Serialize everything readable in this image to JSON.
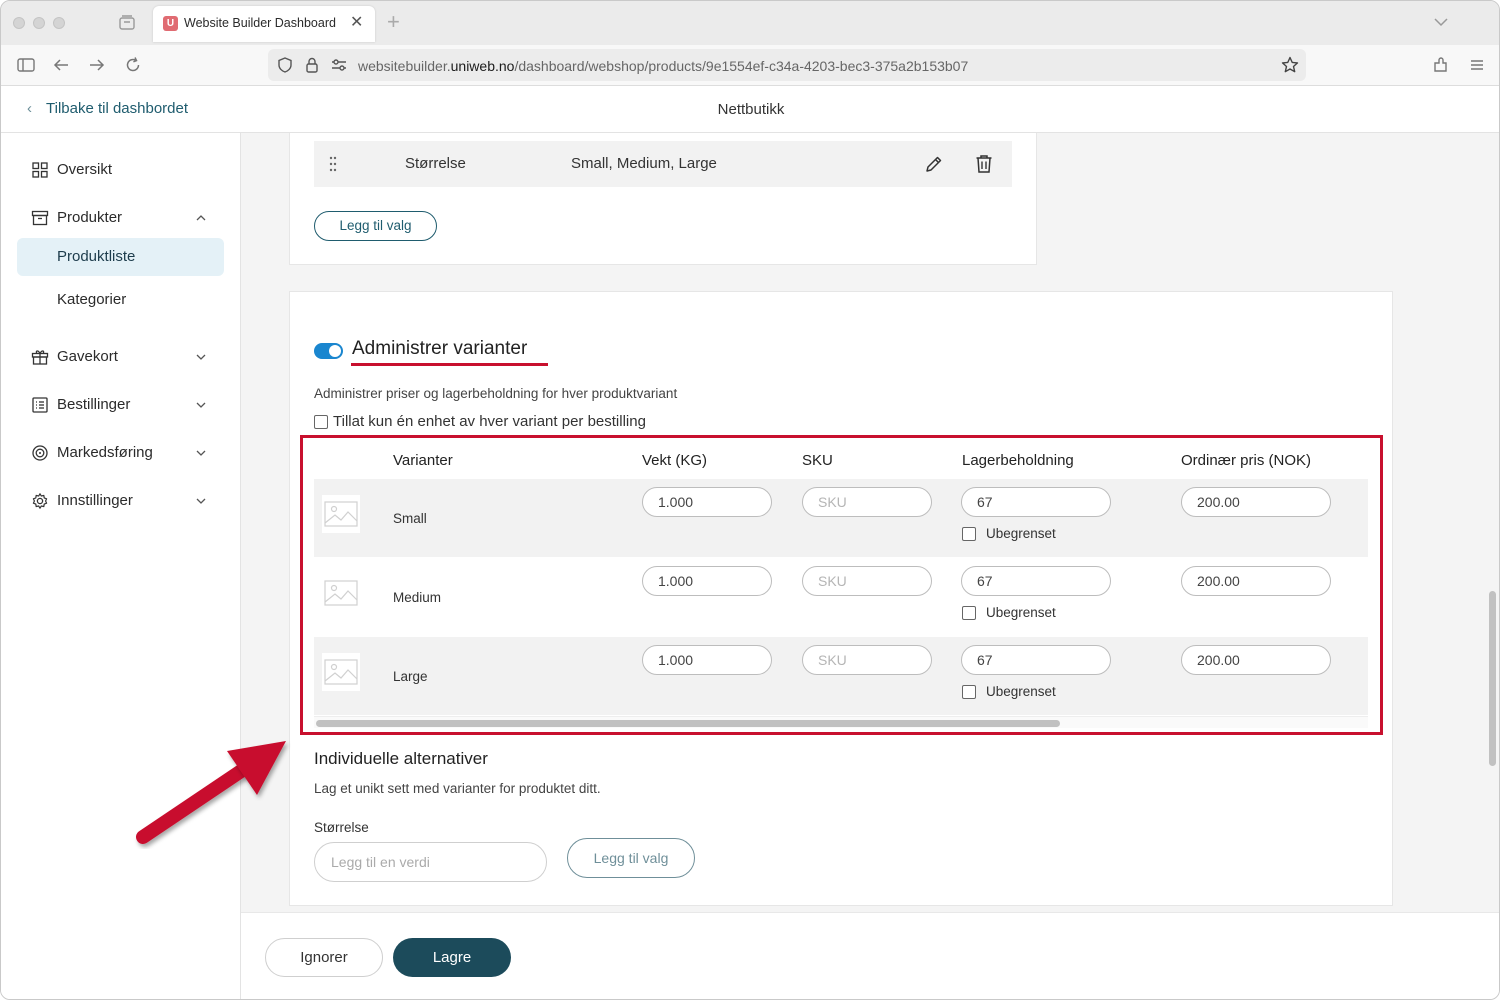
{
  "browser": {
    "tab_title": "Website Builder Dashboard",
    "tab_favicon": "U",
    "tab_close": "✕",
    "new_tab": "+",
    "url_prefix": "websitebuilder.",
    "url_domain": "uniweb.no",
    "url_path": "/dashboard/webshop/products/9e1554ef-c34a-4203-bec3-375a2b153b07"
  },
  "header": {
    "back_label": "Tilbake til dashbordet",
    "back_chevron": "‹",
    "title": "Nettbutikk"
  },
  "sidebar": {
    "items": [
      {
        "label": "Oversikt",
        "icon": "grid-icon"
      },
      {
        "label": "Produkter",
        "icon": "archive-box-icon",
        "expanded": true
      },
      {
        "label": "Produktliste",
        "active": true
      },
      {
        "label": "Kategorier"
      },
      {
        "label": "Gavekort",
        "icon": "gift-icon"
      },
      {
        "label": "Bestillinger",
        "icon": "list-icon"
      },
      {
        "label": "Markedsføring",
        "icon": "target-icon"
      },
      {
        "label": "Innstillinger",
        "icon": "gear-icon"
      }
    ]
  },
  "options_card": {
    "option_name": "Størrelse",
    "option_values": "Small, Medium, Large",
    "add_option_label": "Legg til valg"
  },
  "variants": {
    "toggle_on": true,
    "title": "Administrer varianter",
    "description": "Administrer priser og lagerbeholdning for hver produktvariant",
    "limit_label": "Tillat kun én enhet av hver variant per bestilling",
    "columns": {
      "variant": "Varianter",
      "weight": "Vekt (KG)",
      "sku": "SKU",
      "stock": "Lagerbeholdning",
      "price": "Ordinær pris (NOK)"
    },
    "rows": [
      {
        "name": "Small",
        "weight": "1.000",
        "sku_placeholder": "SKU",
        "stock": "67",
        "unlimited_label": "Ubegrenset",
        "price": "200.00"
      },
      {
        "name": "Medium",
        "weight": "1.000",
        "sku_placeholder": "SKU",
        "stock": "67",
        "unlimited_label": "Ubegrenset",
        "price": "200.00"
      },
      {
        "name": "Large",
        "weight": "1.000",
        "sku_placeholder": "SKU",
        "stock": "67",
        "unlimited_label": "Ubegrenset",
        "price": "200.00"
      }
    ]
  },
  "individual": {
    "title": "Individuelle alternativer",
    "description": "Lag et unikt sett med varianter for produktet ditt.",
    "field_label": "Størrelse",
    "input_placeholder": "Legg til en verdi",
    "add_option_label": "Legg til valg"
  },
  "footer": {
    "ignore_label": "Ignorer",
    "save_label": "Lagre"
  },
  "colors": {
    "accent": "#1c4b5b",
    "toggle": "#1a86cf",
    "annotation": "#c8102e"
  }
}
